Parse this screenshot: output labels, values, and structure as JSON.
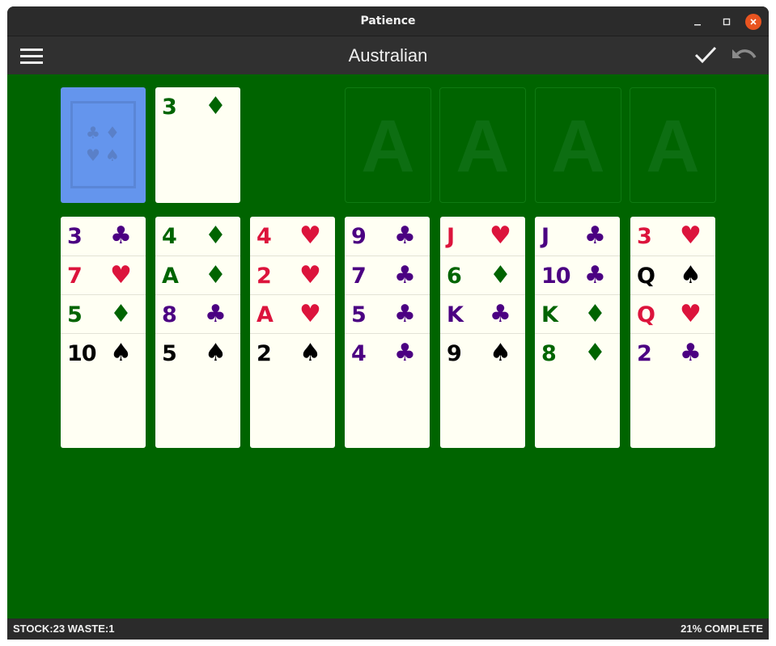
{
  "window": {
    "title": "Patience"
  },
  "header": {
    "title": "Australian"
  },
  "icons": {
    "menu": "hamburger-menu-icon",
    "auto_complete": "checkmark-icon",
    "undo": "undo-icon",
    "minimize": "minimize-icon",
    "maximize": "maximize-icon",
    "close": "close-icon"
  },
  "colors": {
    "felt": "#006400",
    "card_face": "#fffff3",
    "card_back": "#6495ed",
    "hearts": "#dc143c",
    "diamonds": "#006400",
    "clubs": "#4b0082",
    "spades": "#000000"
  },
  "waste": {
    "rank": "3",
    "suit": "♦",
    "color": "green"
  },
  "foundations": [
    "A",
    "A",
    "A",
    "A"
  ],
  "tableau": [
    [
      {
        "rank": "3",
        "suit": "♣",
        "color": "purple"
      },
      {
        "rank": "7",
        "suit": "♥",
        "color": "red"
      },
      {
        "rank": "5",
        "suit": "♦",
        "color": "green"
      },
      {
        "rank": "10",
        "suit": "♠",
        "color": "black"
      }
    ],
    [
      {
        "rank": "4",
        "suit": "♦",
        "color": "green"
      },
      {
        "rank": "A",
        "suit": "♦",
        "color": "green"
      },
      {
        "rank": "8",
        "suit": "♣",
        "color": "purple"
      },
      {
        "rank": "5",
        "suit": "♠",
        "color": "black"
      }
    ],
    [
      {
        "rank": "4",
        "suit": "♥",
        "color": "red"
      },
      {
        "rank": "2",
        "suit": "♥",
        "color": "red"
      },
      {
        "rank": "A",
        "suit": "♥",
        "color": "red"
      },
      {
        "rank": "2",
        "suit": "♠",
        "color": "black"
      }
    ],
    [
      {
        "rank": "9",
        "suit": "♣",
        "color": "purple"
      },
      {
        "rank": "7",
        "suit": "♣",
        "color": "purple"
      },
      {
        "rank": "5",
        "suit": "♣",
        "color": "purple"
      },
      {
        "rank": "4",
        "suit": "♣",
        "color": "purple"
      }
    ],
    [
      {
        "rank": "J",
        "suit": "♥",
        "color": "red"
      },
      {
        "rank": "6",
        "suit": "♦",
        "color": "green"
      },
      {
        "rank": "K",
        "suit": "♣",
        "color": "purple"
      },
      {
        "rank": "9",
        "suit": "♠",
        "color": "black"
      }
    ],
    [
      {
        "rank": "J",
        "suit": "♣",
        "color": "purple"
      },
      {
        "rank": "10",
        "suit": "♣",
        "color": "purple"
      },
      {
        "rank": "K",
        "suit": "♦",
        "color": "green"
      },
      {
        "rank": "8",
        "suit": "♦",
        "color": "green"
      }
    ],
    [
      {
        "rank": "3",
        "suit": "♥",
        "color": "red"
      },
      {
        "rank": "Q",
        "suit": "♠",
        "color": "black"
      },
      {
        "rank": "Q",
        "suit": "♥",
        "color": "red"
      },
      {
        "rank": "2",
        "suit": "♣",
        "color": "purple"
      }
    ]
  ],
  "status": {
    "left": "STOCK:23  WASTE:1",
    "right": "21% COMPLETE"
  }
}
